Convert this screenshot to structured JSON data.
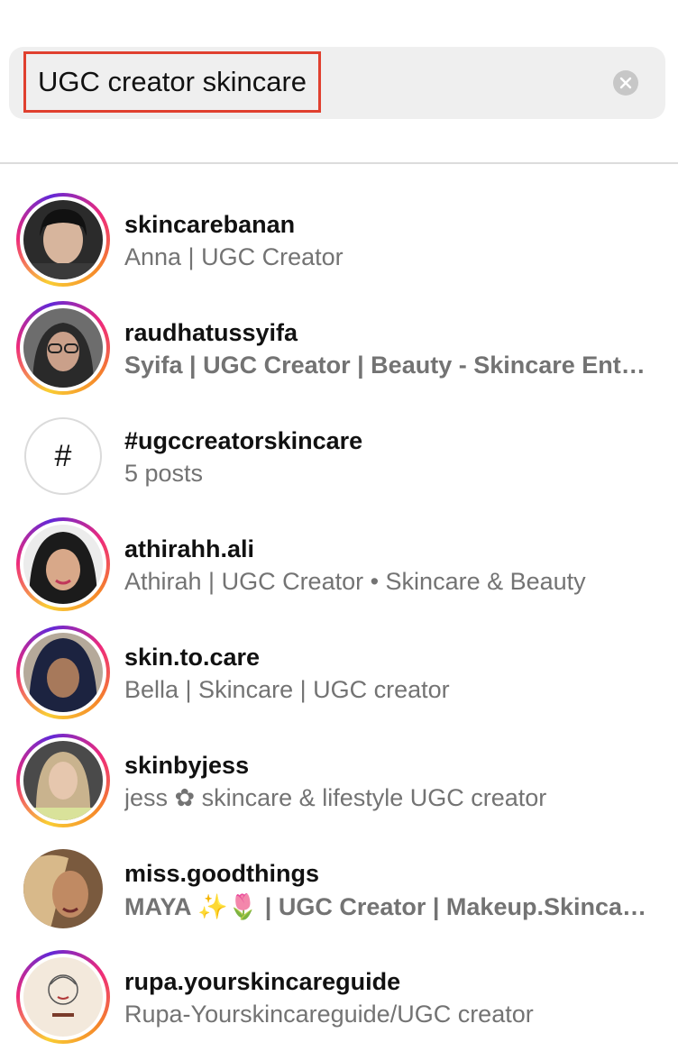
{
  "search": {
    "value": "UGC creator skincare",
    "clear_icon": "close-circle-icon"
  },
  "results": [
    {
      "type": "user",
      "username": "skincarebanan",
      "subtitle": "Anna | UGC Creator",
      "story_ring": true
    },
    {
      "type": "user",
      "username": "raudhatussyifa",
      "subtitle": "Syifa | UGC Creator | Beauty - Skincare Enthu…",
      "story_ring": true
    },
    {
      "type": "hashtag",
      "username": "#ugccreatorskincare",
      "subtitle": "5 posts",
      "symbol": "#"
    },
    {
      "type": "user",
      "username": "athirahh.ali",
      "subtitle": "Athirah | UGC Creator • Skincare & Beauty",
      "story_ring": true
    },
    {
      "type": "user",
      "username": "skin.to.care",
      "subtitle": "Bella | Skincare | UGC creator",
      "story_ring": true
    },
    {
      "type": "user",
      "username": "skinbyjess",
      "subtitle": "jess ✿ skincare & lifestyle UGC creator",
      "story_ring": true
    },
    {
      "type": "user",
      "username": "miss.goodthings",
      "subtitle": "MAYA ✨🌷 | UGC Creator | Makeup.Skincare…",
      "story_ring": false
    },
    {
      "type": "user",
      "username": "rupa.yourskincareguide",
      "subtitle": "Rupa-Yourskincareguide/UGC creator",
      "story_ring": true
    }
  ],
  "colors": {
    "search_bg": "#efefef",
    "highlight": "#e0402f",
    "subtitle": "#737373"
  }
}
